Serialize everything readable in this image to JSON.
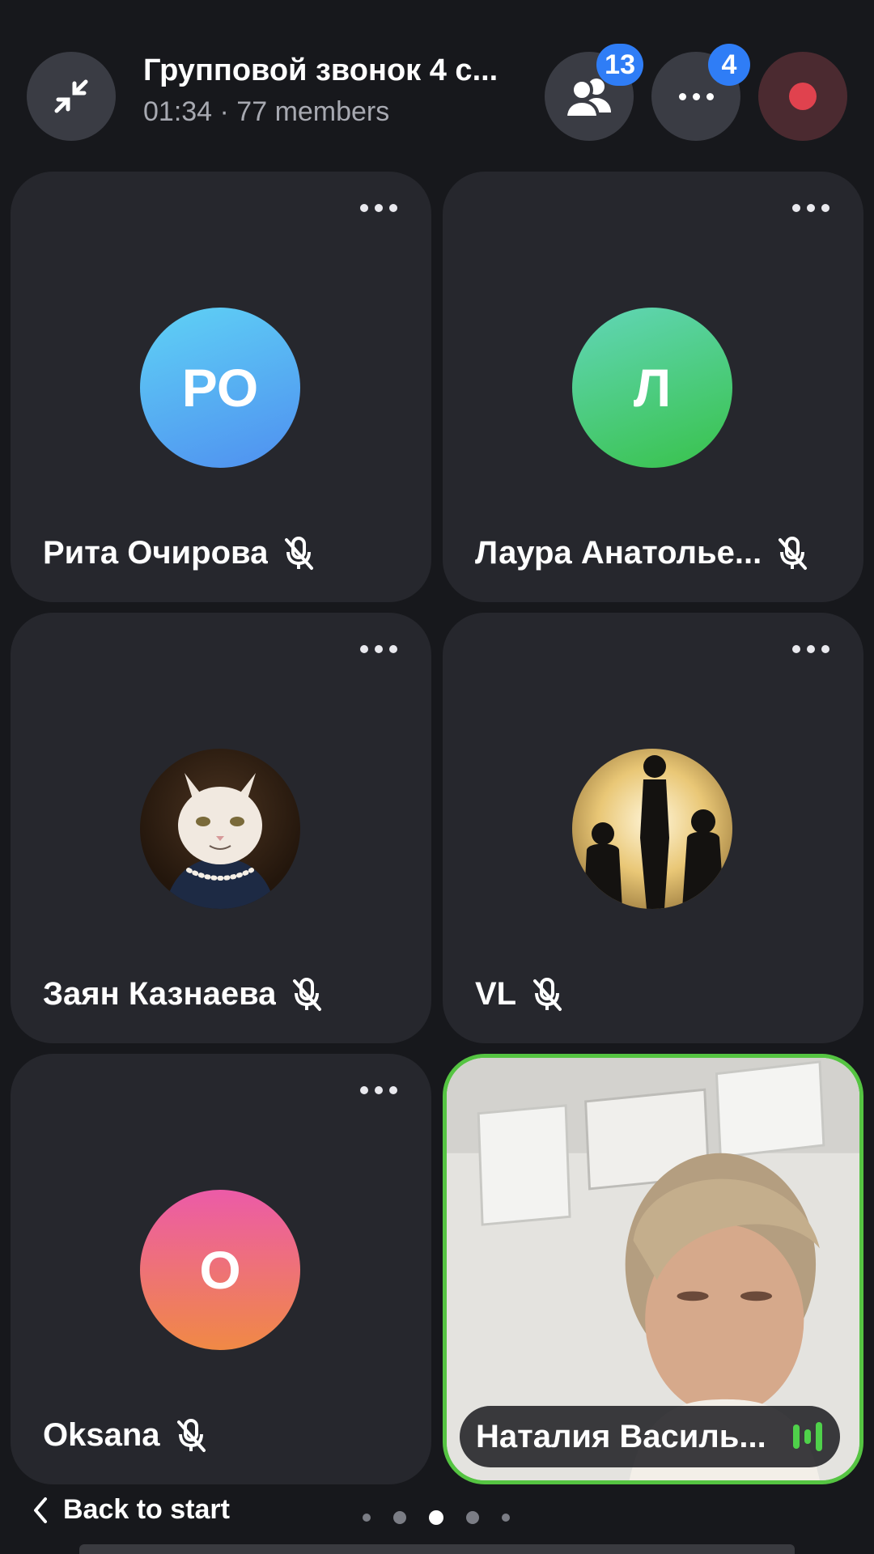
{
  "header": {
    "title": "Групповой звонок 4 с...",
    "subtitle": "01:34 · 77 members",
    "participants_badge": "13",
    "more_badge": "4"
  },
  "tiles": [
    {
      "name": "Рита Очирова",
      "initials": "РО",
      "avatar": "initials",
      "muted": true
    },
    {
      "name": "Лаура Анатолье...",
      "initials": "Л",
      "avatar": "initials",
      "muted": true
    },
    {
      "name": "Заян Казнаева",
      "avatar": "cat-photo",
      "muted": true
    },
    {
      "name": "VL",
      "avatar": "silhouette-photo",
      "muted": true
    },
    {
      "name": "Oksana",
      "initials": "O",
      "avatar": "initials",
      "muted": true
    },
    {
      "name": "Наталия Василь...",
      "avatar": "video",
      "speaking": true
    }
  ],
  "footer": {
    "back_label": "Back to start",
    "page_count": 5,
    "current_page": 3
  },
  "colors": {
    "background": "#17181c",
    "tile": "#26272d",
    "badge": "#2f7df6",
    "speaking_border": "#55c442",
    "record": "#e0424e"
  },
  "icons": [
    "minimize-icon",
    "participants-icon",
    "more-icon",
    "record-icon",
    "mic-off-icon",
    "talking-indicator-icon",
    "chevron-left-icon"
  ]
}
